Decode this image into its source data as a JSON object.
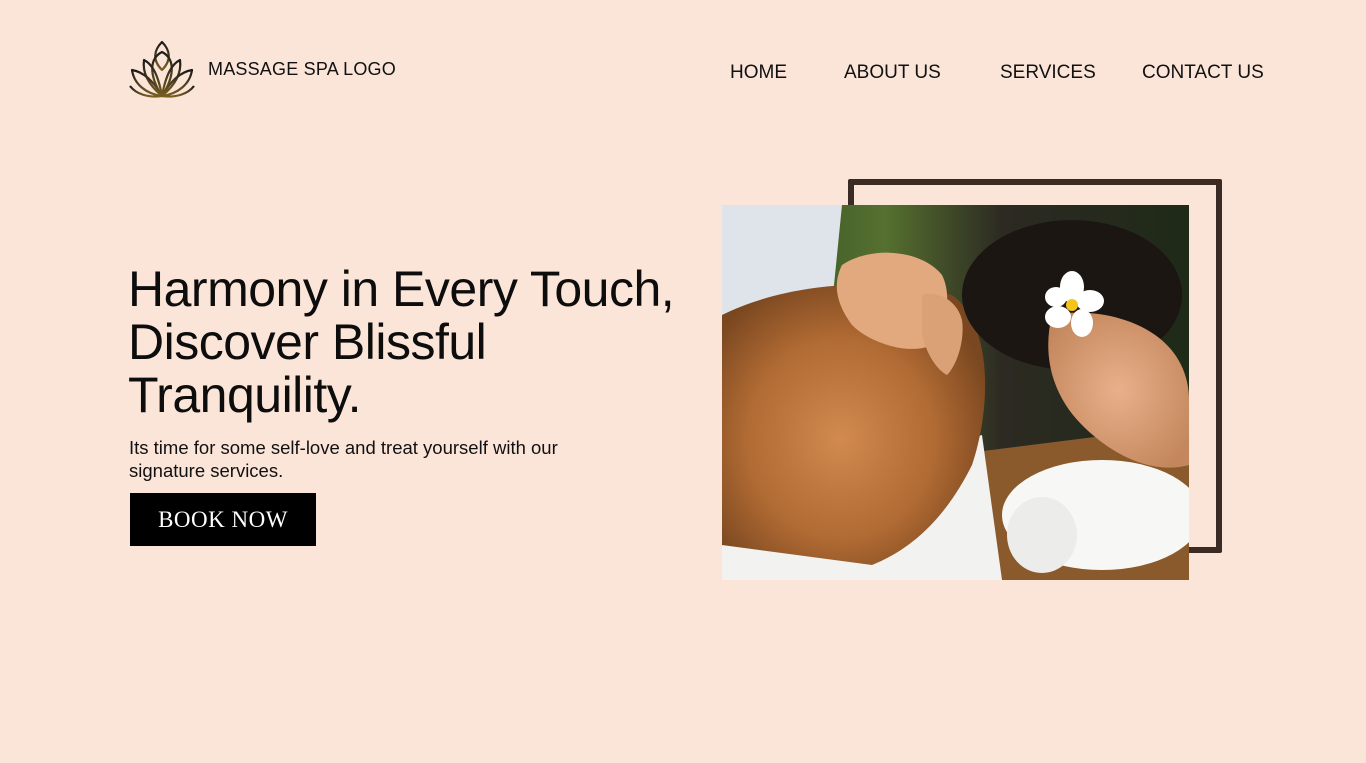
{
  "header": {
    "logo_text": "MASSAGE SPA LOGO",
    "logo_icon": "lotus-icon"
  },
  "nav": {
    "items": [
      {
        "label": "HOME"
      },
      {
        "label": "ABOUT US"
      },
      {
        "label": "SERVICES"
      },
      {
        "label": "CONTACT US"
      }
    ]
  },
  "hero": {
    "headline": "Harmony in Every Touch, Discover Blissful Tranquility.",
    "subtext": "Its time for some self-love and treat yourself with our signature services.",
    "cta_label": "BOOK NOW",
    "image_alt": "massage-photo"
  },
  "colors": {
    "background": "#fbe5d9",
    "frame": "#3a2b24",
    "button": "#000000",
    "logo_gold": "#6b5420"
  }
}
